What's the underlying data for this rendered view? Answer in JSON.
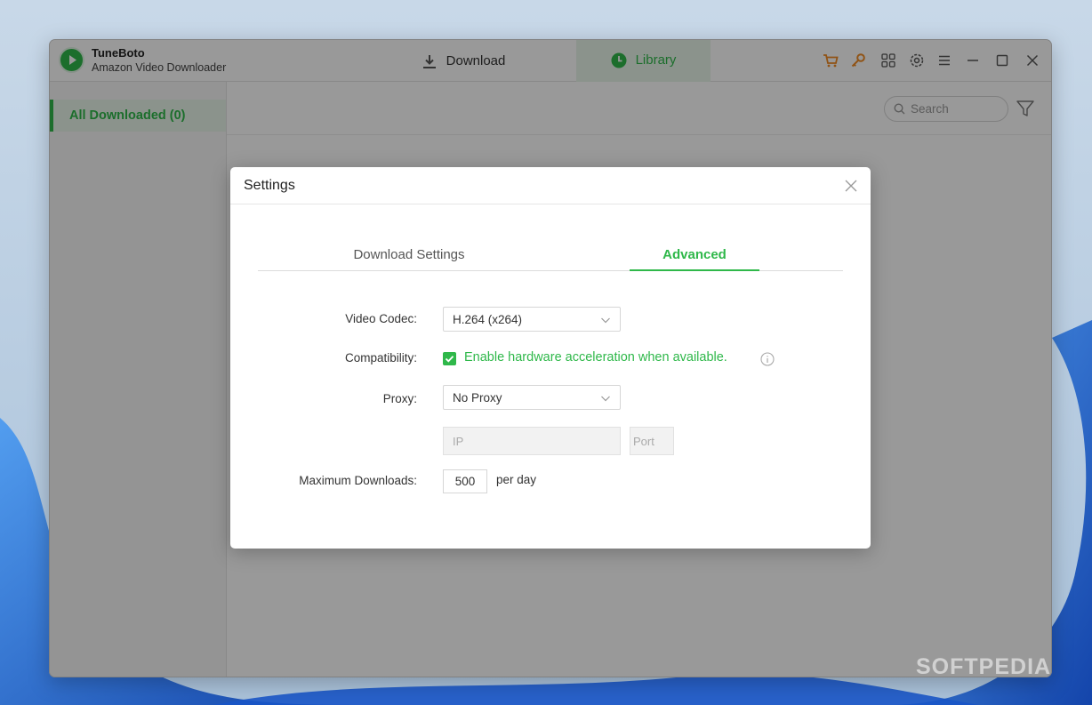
{
  "app": {
    "name": "TuneBoto",
    "subtitle": "Amazon Video Downloader"
  },
  "topbar": {
    "tabs": [
      {
        "label": "Download",
        "icon": "download-icon",
        "active": false
      },
      {
        "label": "Library",
        "icon": "clock-icon",
        "active": true
      }
    ],
    "icons": [
      "cart-icon",
      "key-icon",
      "grid-icon",
      "gear-icon",
      "menu-icon",
      "minimize-icon",
      "maximize-icon",
      "close-icon"
    ]
  },
  "sidebar": {
    "items": [
      {
        "label": "All Downloaded (0)",
        "active": true
      }
    ]
  },
  "toolbar": {
    "search_placeholder": "Search"
  },
  "settings": {
    "title": "Settings",
    "tabs": [
      {
        "label": "Download Settings",
        "active": false
      },
      {
        "label": "Advanced",
        "active": true
      }
    ],
    "video_codec": {
      "label": "Video Codec:",
      "value": "H.264 (x264)"
    },
    "compatibility": {
      "label": "Compatibility:",
      "checkbox_label": "Enable hardware acceleration when available.",
      "checked": true
    },
    "proxy": {
      "label": "Proxy:",
      "value": "No Proxy",
      "ip_placeholder": "IP",
      "port_placeholder": "Port"
    },
    "max_downloads": {
      "label": "Maximum Downloads:",
      "value": "500",
      "unit": "per day"
    }
  },
  "watermark": "SOFTPEDIA",
  "colors": {
    "accent": "#2fb84a",
    "orange": "#f08a24",
    "overlay": "rgba(0,0,0,0.40)"
  }
}
